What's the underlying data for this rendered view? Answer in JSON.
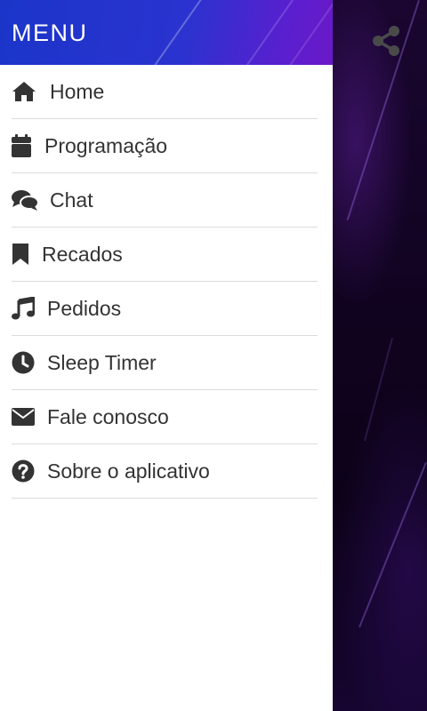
{
  "drawer": {
    "title": "MENU",
    "items": [
      {
        "label": "Home",
        "icon": "home-icon"
      },
      {
        "label": "Programação",
        "icon": "calendar-icon"
      },
      {
        "label": "Chat",
        "icon": "chat-bubbles-icon"
      },
      {
        "label": "Recados",
        "icon": "bookmark-icon"
      },
      {
        "label": "Pedidos",
        "icon": "music-note-icon"
      },
      {
        "label": "Sleep Timer",
        "icon": "clock-icon"
      },
      {
        "label": "Fale conosco",
        "icon": "envelope-icon"
      },
      {
        "label": "Sobre o aplicativo",
        "icon": "question-circle-icon"
      }
    ]
  },
  "toolbar": {
    "share_icon": "share-icon"
  },
  "colors": {
    "header_start": "#1b35c9",
    "header_end": "#6a19c8",
    "icon": "#333333",
    "text": "#333333",
    "divider": "#dcdcdc",
    "background": "#10031f"
  }
}
